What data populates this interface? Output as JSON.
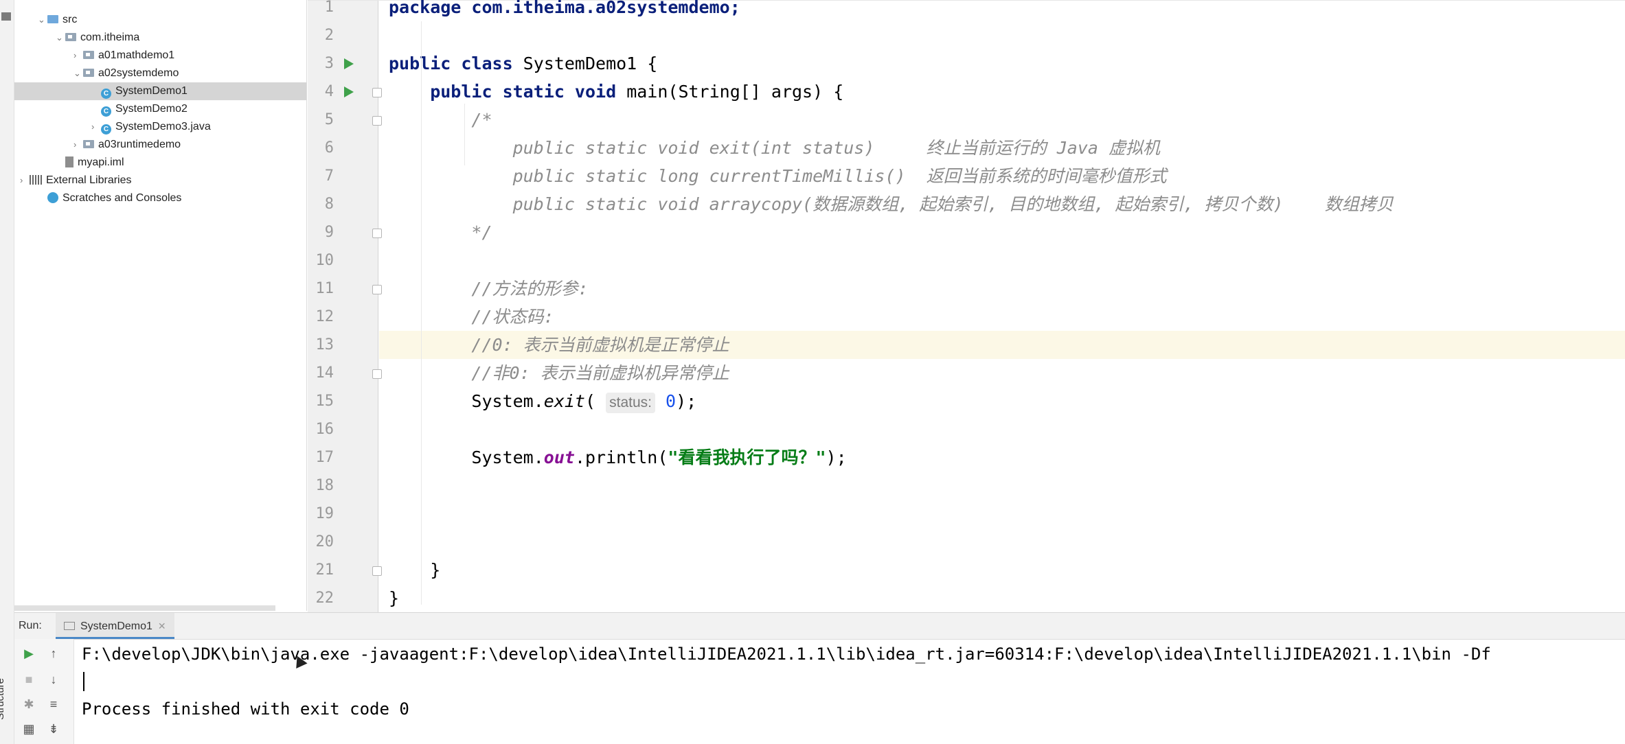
{
  "project_tree": {
    "items": [
      {
        "label": "src",
        "type": "source-folder",
        "expanded": true
      },
      {
        "label": "com.itheima",
        "type": "package",
        "expanded": true
      },
      {
        "label": "a01mathdemo1",
        "type": "package",
        "expanded": false
      },
      {
        "label": "a02systemdemo",
        "type": "package",
        "expanded": true
      },
      {
        "label": "SystemDemo1",
        "type": "class",
        "selected": true
      },
      {
        "label": "SystemDemo2",
        "type": "class"
      },
      {
        "label": "SystemDemo3.java",
        "type": "class",
        "expanded": false
      },
      {
        "label": "a03runtimedemo",
        "type": "package",
        "expanded": false
      },
      {
        "label": "myapi.iml",
        "type": "module-file"
      },
      {
        "label": "External Libraries",
        "type": "library",
        "expanded": false
      },
      {
        "label": "Scratches and Consoles",
        "type": "scratch"
      }
    ]
  },
  "editor": {
    "file": "SystemDemo1",
    "highlighted_line": "13",
    "lines": [
      {
        "num": "1",
        "parts": [
          {
            "t": "package com.itheima.a02systemdemo;",
            "c": "kw"
          }
        ]
      },
      {
        "num": "2",
        "parts": []
      },
      {
        "num": "3",
        "parts": [
          {
            "t": "public class ",
            "c": "kw"
          },
          {
            "t": "SystemDemo1 {",
            "c": ""
          }
        ]
      },
      {
        "num": "4",
        "parts": [
          {
            "t": "    public static void ",
            "c": "kw"
          },
          {
            "t": "main(String[] args) {",
            "c": ""
          }
        ]
      },
      {
        "num": "5",
        "parts": [
          {
            "t": "        /*",
            "c": "com"
          }
        ]
      },
      {
        "num": "6",
        "parts": [
          {
            "t": "            public static void exit(int status)     终止当前运行的 Java 虚拟机",
            "c": "com"
          }
        ]
      },
      {
        "num": "7",
        "parts": [
          {
            "t": "            public static long currentTimeMillis()  返回当前系统的时间毫秒值形式",
            "c": "com"
          }
        ]
      },
      {
        "num": "8",
        "parts": [
          {
            "t": "            public static void arraycopy(数据源数组, 起始索引, 目的地数组, 起始索引, 拷贝个数)    数组拷贝",
            "c": "com"
          }
        ]
      },
      {
        "num": "9",
        "parts": [
          {
            "t": "        */",
            "c": "com"
          }
        ]
      },
      {
        "num": "10",
        "parts": []
      },
      {
        "num": "11",
        "parts": [
          {
            "t": "        //方法的形参:",
            "c": "com"
          }
        ]
      },
      {
        "num": "12",
        "parts": [
          {
            "t": "        //状态码:",
            "c": "com"
          }
        ]
      },
      {
        "num": "13",
        "parts": [
          {
            "t": "        //0: 表示当前虚拟机是正常停止",
            "c": "com"
          }
        ]
      },
      {
        "num": "14",
        "parts": [
          {
            "t": "        //非0: 表示当前虚拟机异常停止",
            "c": "com"
          }
        ]
      },
      {
        "num": "15",
        "parts": [
          {
            "t": "        System.",
            "c": ""
          },
          {
            "t": "exit",
            "c": "italic"
          },
          {
            "t": "( ",
            "c": ""
          },
          {
            "t": "status:",
            "c": "hint"
          },
          {
            "t": " ",
            "c": ""
          },
          {
            "t": "0",
            "c": "num"
          },
          {
            "t": ");",
            "c": ""
          }
        ]
      },
      {
        "num": "16",
        "parts": []
      },
      {
        "num": "17",
        "parts": [
          {
            "t": "        System.",
            "c": ""
          },
          {
            "t": "out",
            "c": "field"
          },
          {
            "t": ".println(",
            "c": ""
          },
          {
            "t": "\"看看我执行了吗？\"",
            "c": "str"
          },
          {
            "t": ");",
            "c": ""
          }
        ]
      },
      {
        "num": "18",
        "parts": []
      },
      {
        "num": "19",
        "parts": []
      },
      {
        "num": "20",
        "parts": []
      },
      {
        "num": "21",
        "parts": [
          {
            "t": "    }",
            "c": ""
          }
        ]
      },
      {
        "num": "22",
        "parts": [
          {
            "t": "}",
            "c": ""
          }
        ]
      }
    ]
  },
  "run_panel": {
    "label": "Run:",
    "tab_label": "SystemDemo1",
    "console_lines": [
      "F:\\develop\\JDK\\bin\\java.exe -javaagent:F:\\develop\\idea\\IntelliJIDEA2021.1.1\\lib\\idea_rt.jar=60314:F:\\develop\\idea\\IntelliJIDEA2021.1.1\\bin -Df",
      "",
      "Process finished with exit code 0"
    ]
  },
  "side_tab": {
    "structure": "Structure"
  },
  "colors": {
    "keyword": "#0a1f7a",
    "comment": "#8c8c8c",
    "string": "#067d17",
    "number": "#1750eb",
    "run_green": "#3fa14a",
    "line_highlight": "#fcf8e6",
    "selection": "#d5d5d5"
  }
}
